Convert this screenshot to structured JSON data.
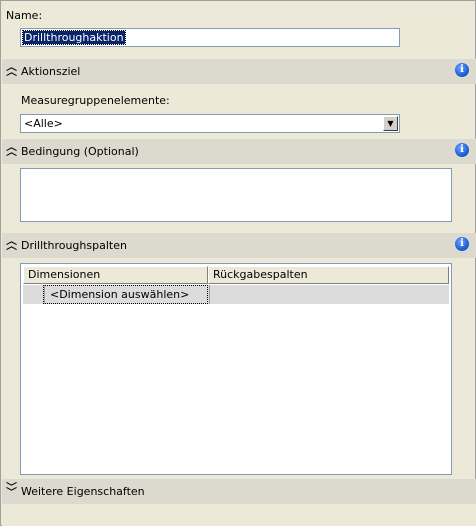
{
  "name_field": {
    "label": "Name:",
    "value": "Drillthroughaktion"
  },
  "sections": {
    "action_target": {
      "title": "Aktionsziel",
      "measure_label": "Measuregruppenelemente:",
      "measure_value": "<Alle>"
    },
    "condition": {
      "title": "Bedingung (Optional)",
      "value": ""
    },
    "drillthrough_columns": {
      "title": "Drillthroughspalten",
      "columns": [
        "Dimensionen",
        "Rückgabespalten"
      ],
      "rows": [
        {
          "dimension": "<Dimension auswählen>",
          "return_columns": ""
        }
      ]
    },
    "more_properties": {
      "title": "Weitere Eigenschaften"
    }
  },
  "icons": {
    "info": "info-icon",
    "collapse": "chevron-double-up-icon",
    "expand": "chevron-double-down-icon",
    "dropdown": "chevron-down-icon"
  },
  "colors": {
    "panel_bg": "#ece9d8",
    "header_bg": "#dcd9cf",
    "selection": "#0a246a",
    "info_blue": "#1e5fd8"
  }
}
